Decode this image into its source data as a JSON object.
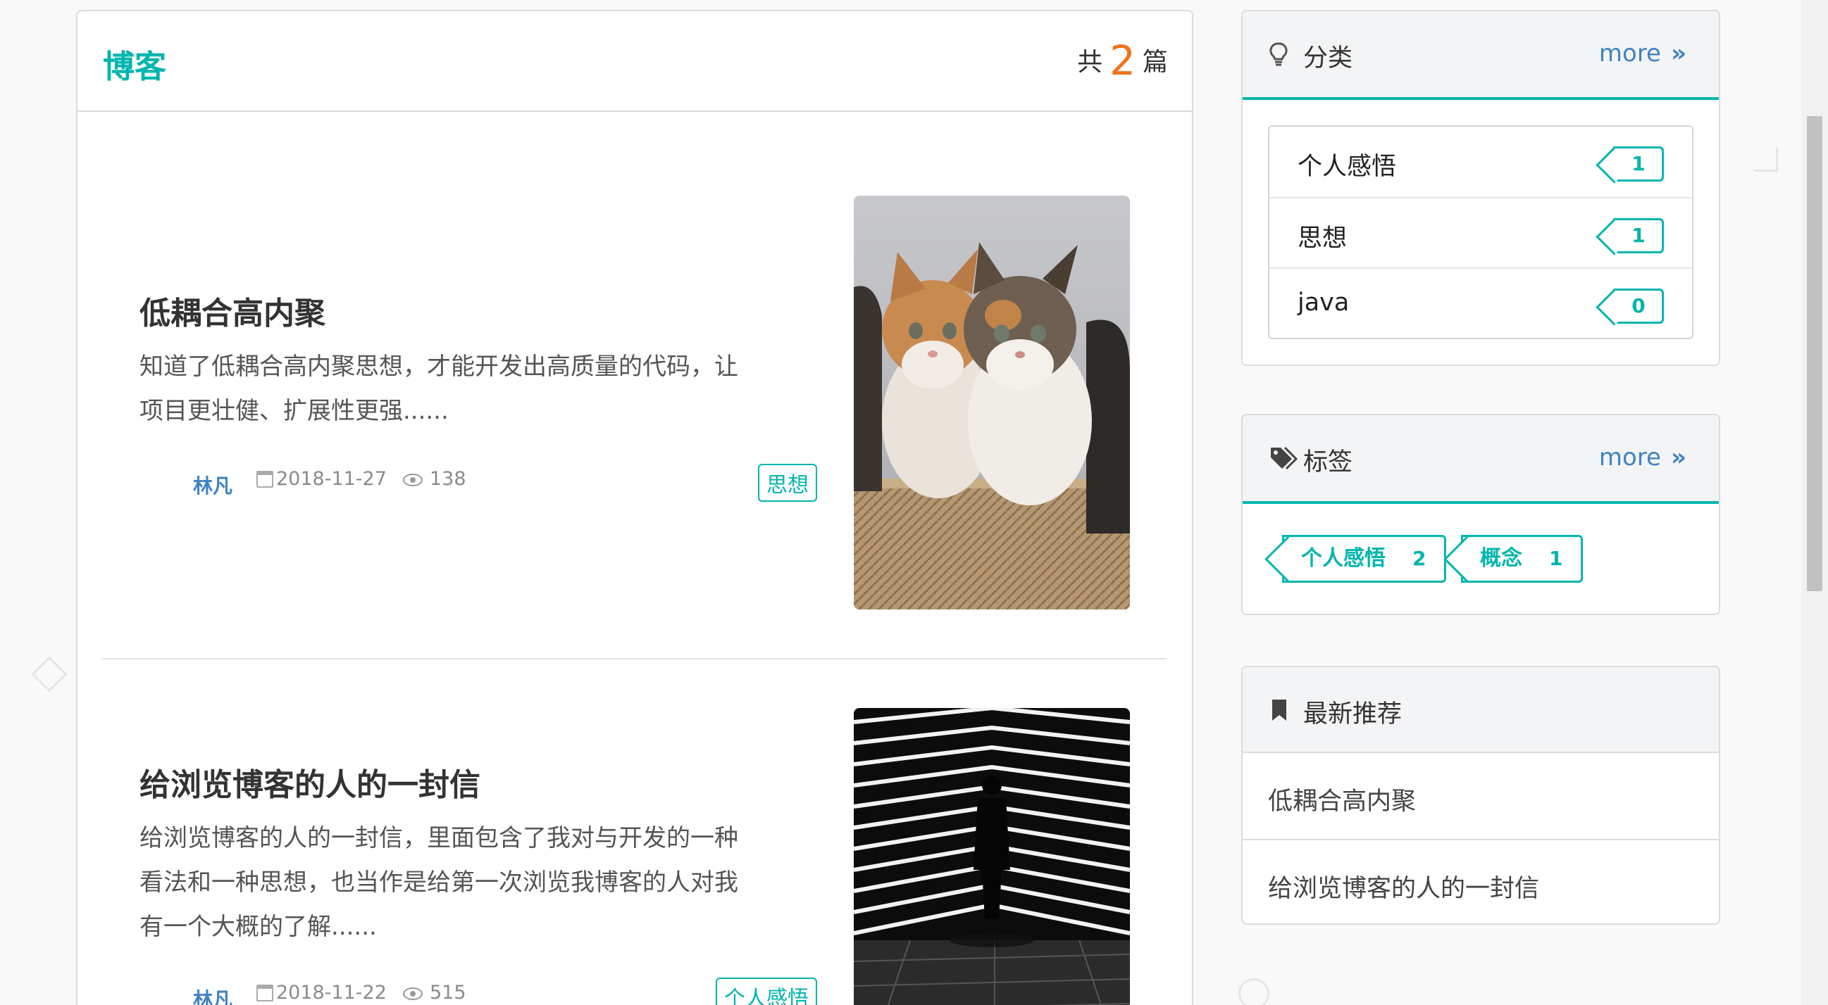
{
  "blog": {
    "title": "博客",
    "count_prefix": "共",
    "count": "2",
    "count_suffix": "篇"
  },
  "posts": [
    {
      "title": "低耦合高内聚",
      "excerpt_line1": "知道了低耦合高内聚思想，才能开发出高质量的代码，让",
      "excerpt_line2": "项目更壮健、扩展性更强......",
      "author": "林凡",
      "date": "2018-11-27",
      "views": "138",
      "tag": "思想",
      "image": "kittens-photo"
    },
    {
      "title": "给浏览博客的人的一封信",
      "excerpt_line1": "给浏览博客的人的一封信，里面包含了我对与开发的一种",
      "excerpt_line2": "看法和一种思想，也当作是给第一次浏览我博客的人对我",
      "excerpt_line3": "有一个大概的了解......",
      "author": "林凡",
      "date": "2018-11-22",
      "views": "515",
      "tag": "个人感悟",
      "image": "light-corridor-silhouette-photo"
    }
  ],
  "sidebar": {
    "categories": {
      "title": "分类",
      "more": "more",
      "icon": "lightbulb-icon",
      "items": [
        {
          "name": "个人感悟",
          "count": "1"
        },
        {
          "name": "思想",
          "count": "1"
        },
        {
          "name": "java",
          "count": "0"
        }
      ]
    },
    "tags": {
      "title": "标签",
      "more": "more",
      "icon": "tags-icon",
      "items": [
        {
          "name": "个人感悟",
          "count": "2"
        },
        {
          "name": "概念",
          "count": "1"
        }
      ]
    },
    "recommend": {
      "title": "最新推荐",
      "icon": "bookmark-icon",
      "items": [
        "低耦合高内聚",
        "给浏览博客的人的一封信"
      ]
    }
  },
  "colors": {
    "accent": "#00b5ad",
    "count_orange": "#f2711c",
    "link_blue": "#4183c4"
  }
}
